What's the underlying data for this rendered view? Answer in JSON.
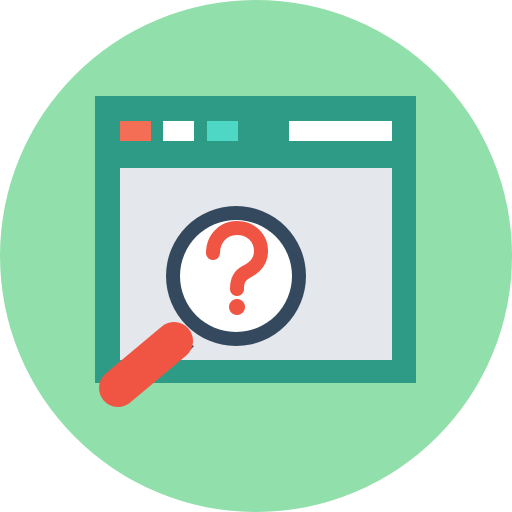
{
  "illustration": {
    "symbol": "?",
    "icons": {
      "background": "circle-badge",
      "window": "browser-window-icon",
      "magnifier": "magnifying-glass-icon",
      "question": "question-mark-icon"
    },
    "colors": {
      "background_circle": "#91DFAA",
      "window_frame": "#2E9B86",
      "window_content": "#E4E7EC",
      "button_red": "#F46D55",
      "button_white": "#FFFFFF",
      "button_teal": "#4ED7C4",
      "address_bar": "#FFFFFF",
      "lens_ring": "#35495E",
      "lens_glass": "#FFFFFF",
      "question_mark": "#F05543",
      "handle": "#F05543"
    }
  }
}
